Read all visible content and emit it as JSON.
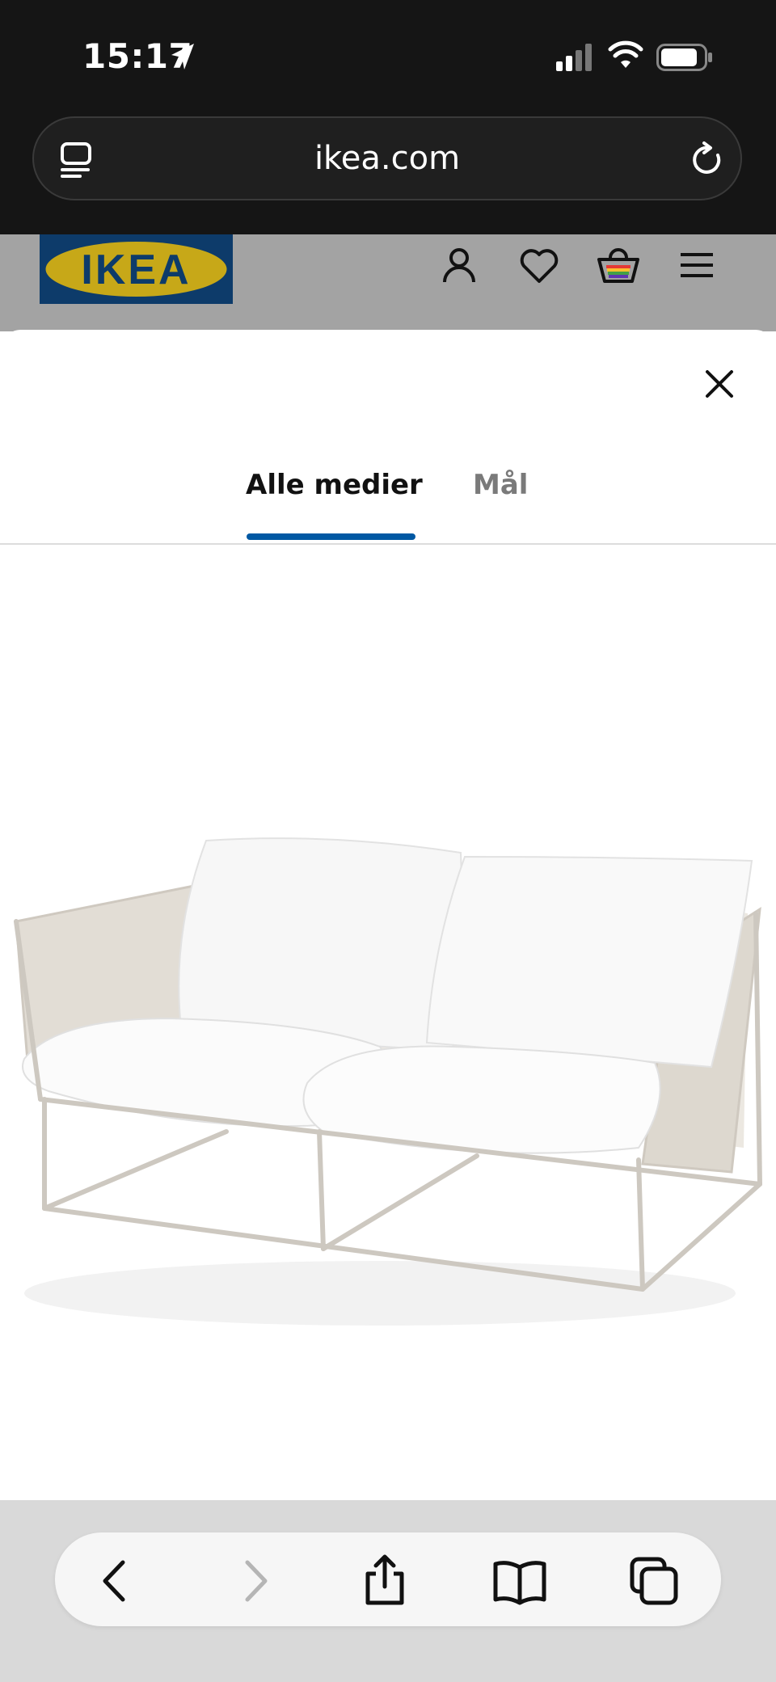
{
  "status_bar": {
    "time": "15:17",
    "icons": [
      "location-arrow-icon",
      "cellular-signal-icon",
      "wifi-icon",
      "battery-icon"
    ]
  },
  "browser": {
    "url": "ikea.com",
    "left_icon": "reader-mode-icon",
    "right_icon": "reload-icon"
  },
  "site_header": {
    "logo_text": "IKEA",
    "icons": [
      "account-icon",
      "wishlist-heart-icon",
      "shopping-bag-icon",
      "hamburger-menu-icon"
    ],
    "colors": {
      "logo_blue": "#0d3b6a",
      "logo_yellow": "#c7a818"
    }
  },
  "media_modal": {
    "tabs": [
      {
        "label": "Alle medier",
        "active": true
      },
      {
        "label": "Mål",
        "active": false
      }
    ],
    "accent_color": "#0058a3",
    "close_icon": "close-icon",
    "image_subject": "two-seat outdoor sofa with white cushions and beige frame"
  },
  "toolbar": {
    "buttons": [
      "back-icon",
      "forward-icon",
      "share-icon",
      "bookmarks-icon",
      "tabs-icon"
    ],
    "forward_disabled": true
  }
}
